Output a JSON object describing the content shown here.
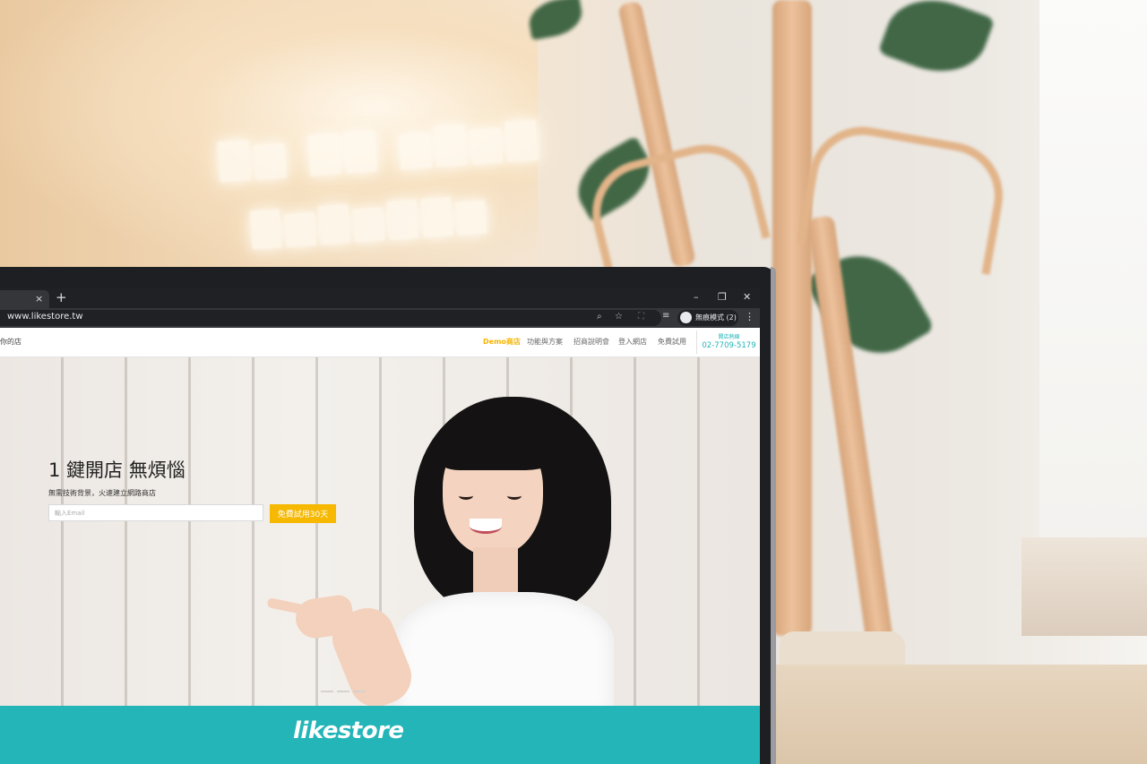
{
  "browser": {
    "tab_close_glyph": "×",
    "new_tab_glyph": "+",
    "window_controls": {
      "minimize": "–",
      "restore": "❐",
      "close": "✕"
    },
    "url": "www.likestore.tw",
    "incognito_label": "無痕模式 (2)",
    "menu_glyph": "⋮"
  },
  "site": {
    "logo_partial": "你的店",
    "nav": [
      {
        "label": "Demo商店",
        "active": true
      },
      {
        "label": "功能與方案",
        "active": false
      },
      {
        "label": "招商說明會",
        "active": false
      },
      {
        "label": "登入網店",
        "active": false
      },
      {
        "label": "免費試用",
        "active": false
      }
    ],
    "hotline_label": "開店熱線",
    "hotline_number": "02-7709-5179",
    "hero": {
      "title": "1 鍵開店 無煩惱",
      "subtitle": "無需技術背景，火速建立網路商店",
      "email_placeholder": "輸入Email",
      "cta_label": "免費試用30天"
    },
    "brand": "likestore"
  },
  "colors": {
    "accent_yellow": "#f6b800",
    "brand_teal": "#23b5b8",
    "browser_dark": "#202124"
  }
}
